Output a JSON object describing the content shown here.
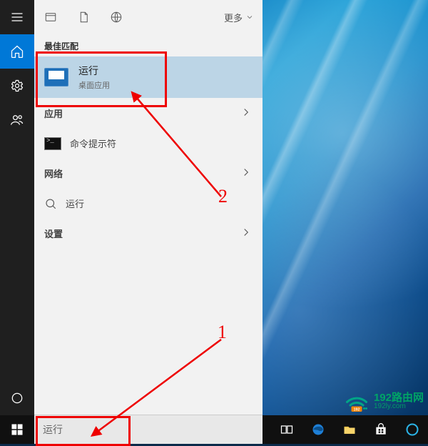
{
  "sidebar": {
    "items": [
      "menu",
      "home",
      "settings",
      "power-user",
      "cortana"
    ]
  },
  "top": {
    "more": "更多"
  },
  "sections": {
    "best_match": "最佳匹配",
    "apps": "应用",
    "network": "网络",
    "settings": "设置"
  },
  "best_result": {
    "title": "运行",
    "subtitle": "桌面应用"
  },
  "app_result": {
    "title": "命令提示符"
  },
  "network_result": {
    "title": "运行"
  },
  "search": {
    "value": "运行"
  },
  "annotations": {
    "n1": "1",
    "n2": "2"
  },
  "watermark": {
    "line1": "192路由网",
    "line2": "192ly.com"
  }
}
